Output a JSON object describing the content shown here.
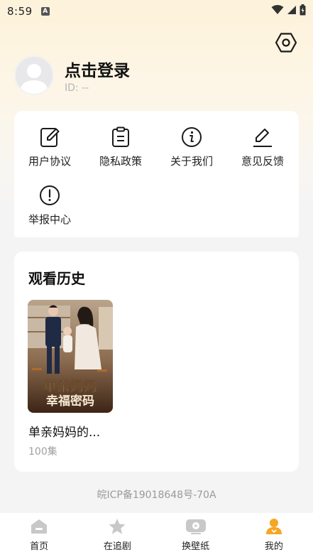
{
  "status_bar": {
    "time": "8:59",
    "notification_icon": "A"
  },
  "header": {
    "settings_icon": "hexagon-settings-icon"
  },
  "profile": {
    "login_text": "点击登录",
    "user_id": "ID: --"
  },
  "menu": {
    "items": [
      {
        "label": "用户协议",
        "icon": "edit-document-icon"
      },
      {
        "label": "隐私政策",
        "icon": "clipboard-icon"
      },
      {
        "label": "关于我们",
        "icon": "info-icon"
      },
      {
        "label": "意见反馈",
        "icon": "pen-icon"
      },
      {
        "label": "举报中心",
        "icon": "alert-icon"
      }
    ]
  },
  "history": {
    "title": "观看历史",
    "items": [
      {
        "title": "单亲妈妈的...",
        "episodes": "100集",
        "poster_text_line1": "单亲妈妈",
        "poster_text_line2": "幸福密码"
      }
    ]
  },
  "footer": {
    "icp": "皖ICP备19018648号-70A"
  },
  "bottom_nav": {
    "items": [
      {
        "label": "首页",
        "icon": "home-icon",
        "active": false
      },
      {
        "label": "在追剧",
        "icon": "star-icon",
        "active": false
      },
      {
        "label": "换壁纸",
        "icon": "wallpaper-icon",
        "active": false
      },
      {
        "label": "我的",
        "icon": "profile-icon",
        "active": true
      }
    ]
  },
  "colors": {
    "accent": "#f5a623",
    "nav_inactive": "#c8c8c8",
    "background": "#f4f4f4"
  }
}
